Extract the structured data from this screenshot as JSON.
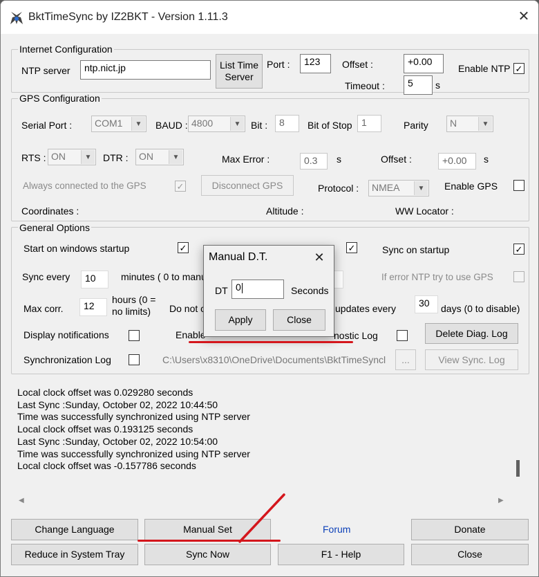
{
  "window": {
    "title": "BktTimeSync by IZ2BKT - Version 1.11.3",
    "close_glyph": "✕"
  },
  "internet": {
    "group_label": "Internet Configuration",
    "ntp_server_label": "NTP server",
    "ntp_server_value": "ntp.nict.jp",
    "list_time_server_label": "List Time Server",
    "port_label": "Port :",
    "port_value": "123",
    "offset_label": "Offset :",
    "offset_value": "+0.00",
    "enable_ntp_label": "Enable NTP",
    "enable_ntp_checked": "✓",
    "timeout_label": "Timeout :",
    "timeout_value": "5",
    "timeout_unit": "s"
  },
  "gps": {
    "group_label": "GPS Configuration",
    "serial_port_label": "Serial Port :",
    "serial_port_value": "COM1",
    "baud_label": "BAUD :",
    "baud_value": "4800",
    "bit_label": "Bit :",
    "bit_value": "8",
    "bit_of_stop_label": "Bit of Stop",
    "bit_of_stop_value": "1",
    "parity_label": "Parity",
    "parity_value": "N",
    "rts_label": "RTS :",
    "rts_value": "ON",
    "dtr_label": "DTR :",
    "dtr_value": "ON",
    "max_error_label": "Max Error :",
    "max_error_value": "0.3",
    "max_error_unit": "s",
    "offset_label": "Offset :",
    "offset_value": "+0.00",
    "offset_unit": "s",
    "always_connected_label": "Always connected to the GPS",
    "always_connected_checked": "✓",
    "disconnect_gps_label": "Disconnect GPS",
    "protocol_label": "Protocol :",
    "protocol_value": "NMEA",
    "enable_gps_label": "Enable GPS",
    "coordinates_label": "Coordinates :",
    "altitude_label": "Altitude :",
    "ww_locator_label": "WW Locator :"
  },
  "general": {
    "group_label": "General Options",
    "start_on_startup_label": "Start on windows startup",
    "start_on_startup_checked": "✓",
    "middle_checked": "✓",
    "sync_on_startup_label": "Sync on startup",
    "sync_on_startup_checked": "✓",
    "sync_every_label": "Sync every",
    "sync_every_value": "10",
    "minutes_label": "minutes ( 0 to manu",
    "if_error_label": "If error NTP try to use GPS",
    "max_corr_label": "Max corr.",
    "max_corr_value": "12",
    "hours_label": "hours (0 = no limits)",
    "do_not_label": "Do not c",
    "updates_every_label": "updates every",
    "updates_every_value": "30",
    "days_label": "days (0 to disable)",
    "display_notifications_label": "Display notifications",
    "enable_label": "Enable",
    "diagnostic_log_label": "nostic Log",
    "delete_diag_log_label": "Delete Diag. Log",
    "sync_log_label": "Synchronization Log",
    "log_path_value": "C:\\Users\\x8310\\OneDrive\\Documents\\BktTimeSyncl",
    "browse_label": "...",
    "view_sync_log_label": "View Sync. Log"
  },
  "log": {
    "lines": [
      "Local clock offset was 0.029280 seconds",
      "Last Sync :Sunday, October 02, 2022 10:44:50",
      "Time was successfully synchronized using NTP server",
      "Local clock offset was 0.193125 seconds",
      "Last Sync :Sunday, October 02, 2022 10:54:00",
      "Time was successfully synchronized using NTP server",
      "Local clock offset was -0.157786 seconds"
    ],
    "scroll_left_glyph": "◀",
    "scroll_right_glyph": "▶"
  },
  "bottom": {
    "change_language_label": "Change Language",
    "manual_set_label": "Manual Set",
    "forum_label": "Forum",
    "donate_label": "Donate",
    "reduce_tray_label": "Reduce in System Tray",
    "sync_now_label": "Sync Now",
    "help_label": "F1 - Help",
    "close_label": "Close"
  },
  "dialog": {
    "title": "Manual D.T.",
    "close_glyph": "✕",
    "dt_label": "DT",
    "dt_value": "0",
    "seconds_label": "Seconds",
    "apply_label": "Apply",
    "close_label": "Close"
  },
  "colors": {
    "annotation_red": "#d4161c",
    "forum_link": "#0b3fb8"
  }
}
